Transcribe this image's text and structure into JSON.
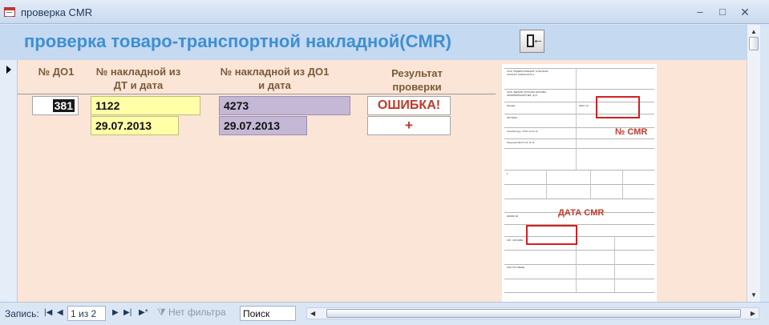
{
  "window": {
    "title": "проверка CMR",
    "min_glyph": "–",
    "max_glyph": "□",
    "close_glyph": "✕"
  },
  "form": {
    "heading": "проверка товаро-транспортной накладной(CMR)",
    "columns": {
      "do1": "№ ДО1",
      "dt_line1": "№ накладной из",
      "dt_line2": "ДТ и дата",
      "do1_line1": "№ накладной из ДО1",
      "do1_line2": "и дата",
      "result_line1": "Результат",
      "result_line2": "проверки"
    },
    "record": {
      "do1_number": "381",
      "dt_invoice_number": "1122",
      "dt_invoice_date": "29.07.2013",
      "do1_invoice_number": "4273",
      "do1_invoice_date": "29.07.2013",
      "result_number": "ОШИБКА!",
      "result_date": "+"
    },
    "annotations": {
      "cmr_number": "№ CMR",
      "cmr_date": "ДАТА CMR"
    }
  },
  "statusbar": {
    "record_label": "Запись:",
    "position": "1 из 2",
    "filter": "Нет фильтра",
    "search_placeholder": "Поиск",
    "nav_first": "|◀",
    "nav_prev": "◀",
    "nav_next": "▶",
    "nav_last": "▶|",
    "nav_new": "▶*"
  },
  "colors": {
    "heading": "#3f8fd2",
    "error": "#c0392b",
    "form_bg": "#fbe5d6",
    "header_band": "#c5d9f1",
    "yellow_field": "#ffffa8",
    "purple_field": "#c4b8d6"
  },
  "icons": [
    "app-form-icon",
    "exit-door-icon",
    "record-selector-arrow-icon",
    "filter-icon"
  ]
}
